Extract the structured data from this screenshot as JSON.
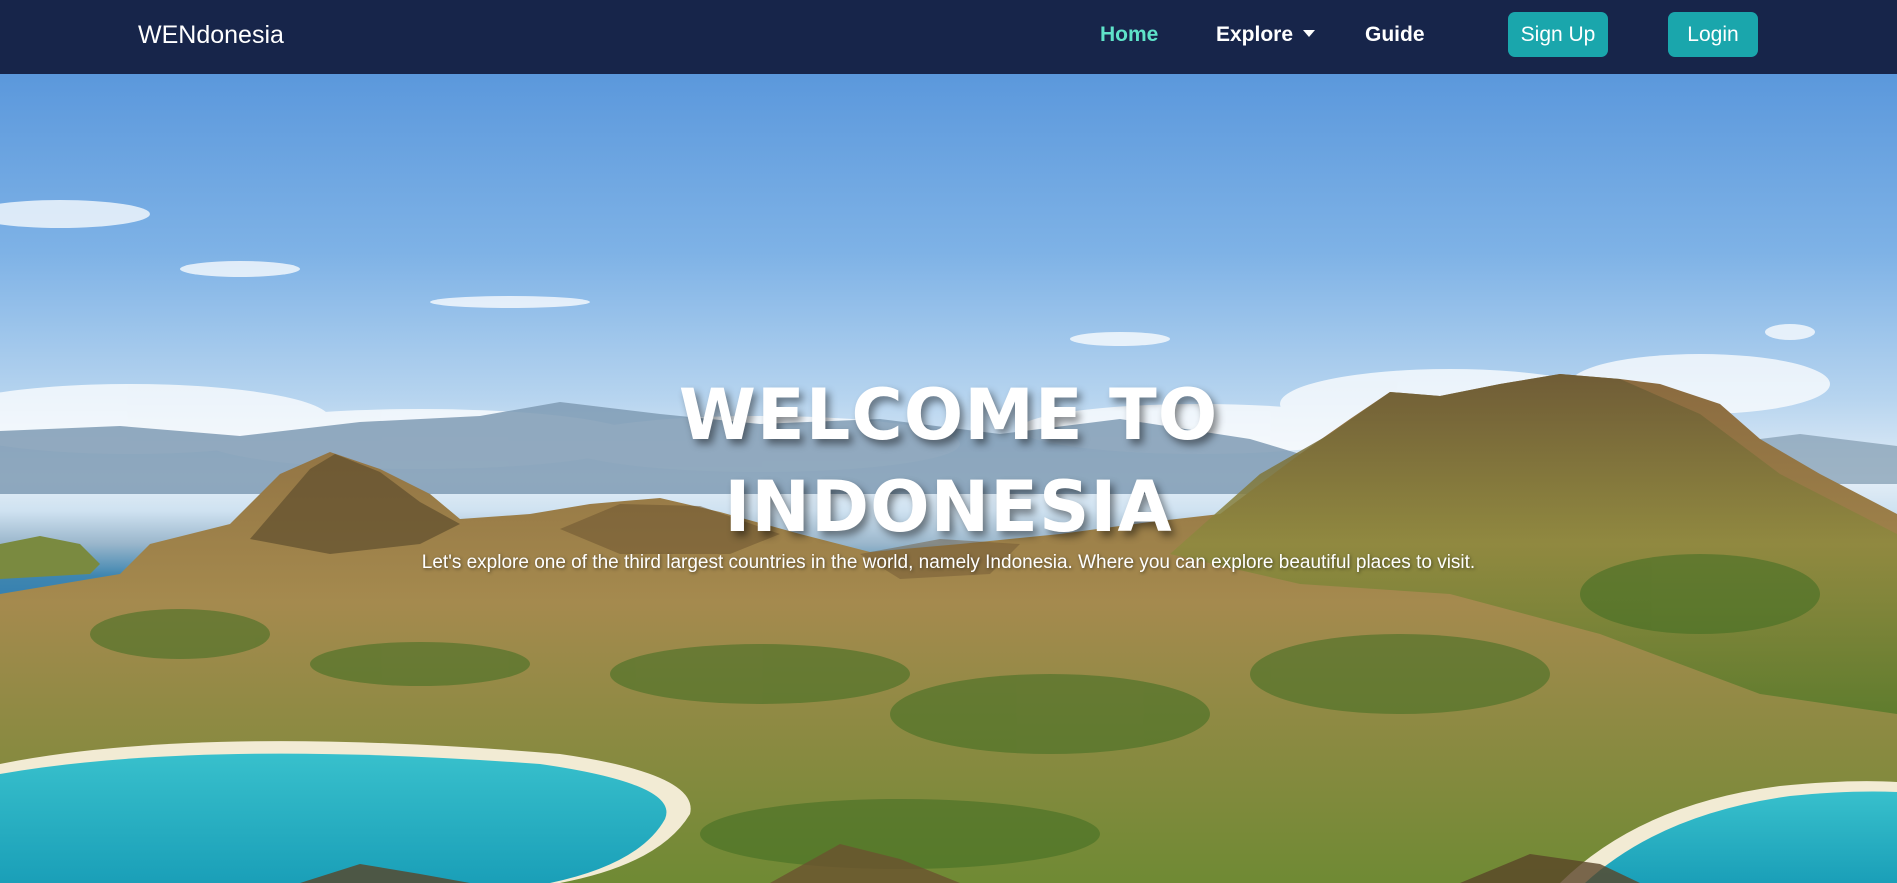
{
  "navbar": {
    "brand": "WENdonesia",
    "links": {
      "home": "Home",
      "explore": "Explore",
      "guide": "Guide"
    },
    "signup_label": "Sign Up",
    "login_label": "Login",
    "active_color": "#5fe3c9",
    "background_color": "#17254a",
    "button_color": "#1aa6ac"
  },
  "hero": {
    "title_line1": "WELCOME TO",
    "title_line2": "INDONESIA",
    "subtitle": "Let's explore one of the third largest countries in the world, namely Indonesia. Where you can explore beautiful places to visit."
  }
}
